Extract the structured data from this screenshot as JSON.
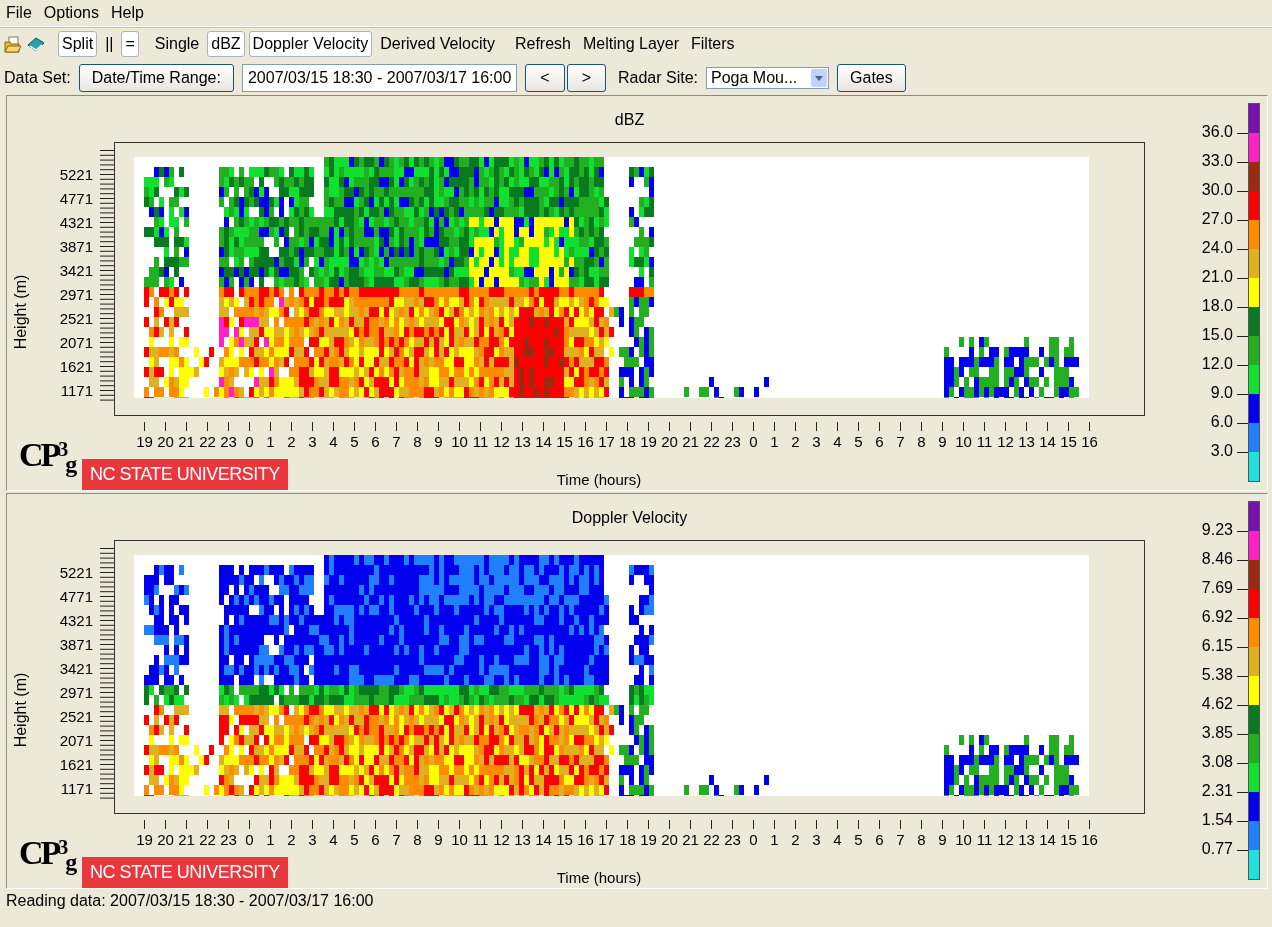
{
  "menu": [
    "File",
    "Options",
    "Help"
  ],
  "toolbar": [
    {
      "label": "Split",
      "selected": true
    },
    {
      "label": "||",
      "selected": false
    },
    {
      "label": "=",
      "selected": true
    },
    {
      "label": "Single",
      "selected": false
    },
    {
      "label": "dBZ",
      "selected": true
    },
    {
      "label": "Doppler Velocity",
      "selected": true
    },
    {
      "label": "Derived Velocity",
      "selected": false
    },
    {
      "label": "Refresh",
      "selected": false
    },
    {
      "label": "Melting Layer",
      "selected": false
    },
    {
      "label": "Filters",
      "selected": false
    }
  ],
  "dataset_bar": {
    "label": "Data Set:",
    "range_button": "Date/Time Range:",
    "range_value": "2007/03/15 18:30 - 2007/03/17 16:00",
    "prev_button": "<",
    "next_button": ">",
    "site_label": "Radar Site:",
    "site_value": "Poga Mou...",
    "gates_button": "Gates"
  },
  "panels": [
    {
      "title": "dBZ",
      "kind": "reflectivity",
      "ylabel": "Height (m)",
      "xlabel": "Time (hours)",
      "logo": "CP$^{3}$$_{g}$",
      "badge": "**NC STATE** UNIVERSITY",
      "yticks": [
        "5221",
        "4771",
        "4321",
        "3871",
        "3421",
        "2971",
        "2521",
        "2071",
        "1621",
        "1171"
      ],
      "xticks": [
        "19",
        "20",
        "21",
        "22",
        "23",
        "0",
        "1",
        "2",
        "3",
        "4",
        "5",
        "6",
        "7",
        "8",
        "9",
        "10",
        "11",
        "12",
        "13",
        "14",
        "15",
        "16",
        "17",
        "18",
        "19",
        "20",
        "21",
        "22",
        "23",
        "0",
        "1",
        "2",
        "3",
        "4",
        "5",
        "6",
        "7",
        "8",
        "9",
        "10",
        "11",
        "12",
        "13",
        "14",
        "15",
        "16"
      ],
      "colorbar": {
        "segments": [
          {
            "color": "#7a10b0"
          },
          {
            "color": "#ff20c8"
          },
          {
            "color": "#9a2a10"
          },
          {
            "color": "#ff0000"
          },
          {
            "color": "#ff8c00"
          },
          {
            "color": "#e0b020"
          },
          {
            "color": "#ffff00"
          },
          {
            "color": "#0a7a20"
          },
          {
            "color": "#22b022"
          },
          {
            "color": "#10e030"
          },
          {
            "color": "#0000ee"
          },
          {
            "color": "#2080ff"
          },
          {
            "color": "#20e0e0"
          }
        ],
        "labels": [
          "36.0",
          "33.0",
          "30.0",
          "27.0",
          "24.0",
          "21.0",
          "18.0",
          "15.0",
          "12.0",
          "9.0",
          "6.0",
          "3.0"
        ]
      }
    },
    {
      "title": "Doppler Velocity",
      "kind": "velocity",
      "ylabel": "Height (m)",
      "xlabel": "Time (hours)",
      "logo": "CP$^{3}$$_{g}$",
      "badge": "**NC STATE** UNIVERSITY",
      "yticks": [
        "5221",
        "4771",
        "4321",
        "3871",
        "3421",
        "2971",
        "2521",
        "2071",
        "1621",
        "1171"
      ],
      "xticks": [
        "19",
        "20",
        "21",
        "22",
        "23",
        "0",
        "1",
        "2",
        "3",
        "4",
        "5",
        "6",
        "7",
        "8",
        "9",
        "10",
        "11",
        "12",
        "13",
        "14",
        "15",
        "16",
        "17",
        "18",
        "19",
        "20",
        "21",
        "22",
        "23",
        "0",
        "1",
        "2",
        "3",
        "4",
        "5",
        "6",
        "7",
        "8",
        "9",
        "10",
        "11",
        "12",
        "13",
        "14",
        "15",
        "16"
      ],
      "colorbar": {
        "segments": [
          {
            "color": "#7a10b0"
          },
          {
            "color": "#ff20c8"
          },
          {
            "color": "#9a2a10"
          },
          {
            "color": "#ff0000"
          },
          {
            "color": "#ff8c00"
          },
          {
            "color": "#e0b020"
          },
          {
            "color": "#ffff00"
          },
          {
            "color": "#0a7a20"
          },
          {
            "color": "#22b022"
          },
          {
            "color": "#10e030"
          },
          {
            "color": "#0000ee"
          },
          {
            "color": "#2080ff"
          },
          {
            "color": "#20e0e0"
          }
        ],
        "labels": [
          "9.23",
          "8.46",
          "7.69",
          "6.92",
          "6.15",
          "5.38",
          "4.62",
          "3.85",
          "3.08",
          "2.31",
          "1.54",
          "0.77"
        ]
      }
    }
  ],
  "status_bar": "Reading data: 2007/03/15 18:30 - 2007/03/17 16:00"
}
